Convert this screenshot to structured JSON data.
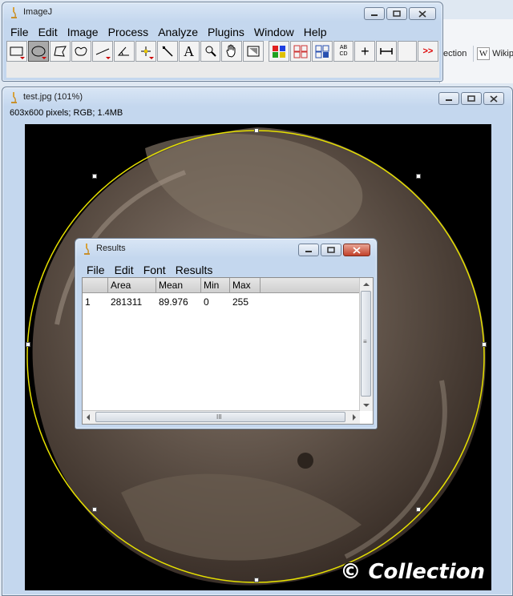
{
  "browser_background": {
    "tab_collection": "ection",
    "tab_wiki": "Wikip"
  },
  "imagej": {
    "title": "ImageJ",
    "menu": [
      "File",
      "Edit",
      "Image",
      "Process",
      "Analyze",
      "Plugins",
      "Window",
      "Help"
    ],
    "tools": [
      {
        "name": "rectangle-tool",
        "icon": "rectangle-icon"
      },
      {
        "name": "oval-tool",
        "icon": "oval-icon",
        "active": true
      },
      {
        "name": "polygon-tool",
        "icon": "polygon-icon"
      },
      {
        "name": "freehand-tool",
        "icon": "freehand-icon"
      },
      {
        "name": "line-tool",
        "icon": "line-icon"
      },
      {
        "name": "angle-tool",
        "icon": "angle-icon"
      },
      {
        "name": "point-tool",
        "icon": "point-icon"
      },
      {
        "name": "wand-tool",
        "icon": "wand-icon"
      },
      {
        "name": "text-tool",
        "icon": "text-icon",
        "label": "A"
      },
      {
        "name": "magnifier-tool",
        "icon": "magnifier-icon"
      },
      {
        "name": "hand-tool",
        "icon": "hand-icon"
      },
      {
        "name": "dropper-tool",
        "icon": "dropper-icon"
      },
      {
        "name": "color-picker-tool",
        "icon": "color-grid-icon"
      },
      {
        "name": "roi-manager-tool",
        "icon": "roi-grid-icon"
      },
      {
        "name": "stack-tool",
        "icon": "stack-grid-icon"
      },
      {
        "name": "label-tool",
        "icon": "abcd-icon",
        "label": "AB CD"
      },
      {
        "name": "crosshair-tool",
        "icon": "plus-icon",
        "label": "+"
      },
      {
        "name": "measure-tool",
        "icon": "ruler-icon"
      },
      {
        "name": "blank-tool",
        "icon": "blank-icon"
      },
      {
        "name": "more-tools",
        "icon": "more-icon",
        "label": ">>"
      }
    ]
  },
  "image_window": {
    "title": "test.jpg (101%)",
    "info": "603x600 pixels; RGB; 1.4MB",
    "watermark": "© Collection"
  },
  "results": {
    "title": "Results",
    "menu": [
      "File",
      "Edit",
      "Font",
      "Results"
    ],
    "columns": [
      "",
      "Area",
      "Mean",
      "Min",
      "Max"
    ],
    "rows": [
      [
        "1",
        "281311",
        "89.976",
        "0",
        "255"
      ]
    ],
    "hscroll_grip": "III",
    "vscroll_grip": "≡"
  },
  "colors": {
    "title_gradient": "#c4d7ee",
    "close_button": "#c2412b",
    "roi_outline": "#e6e000"
  }
}
